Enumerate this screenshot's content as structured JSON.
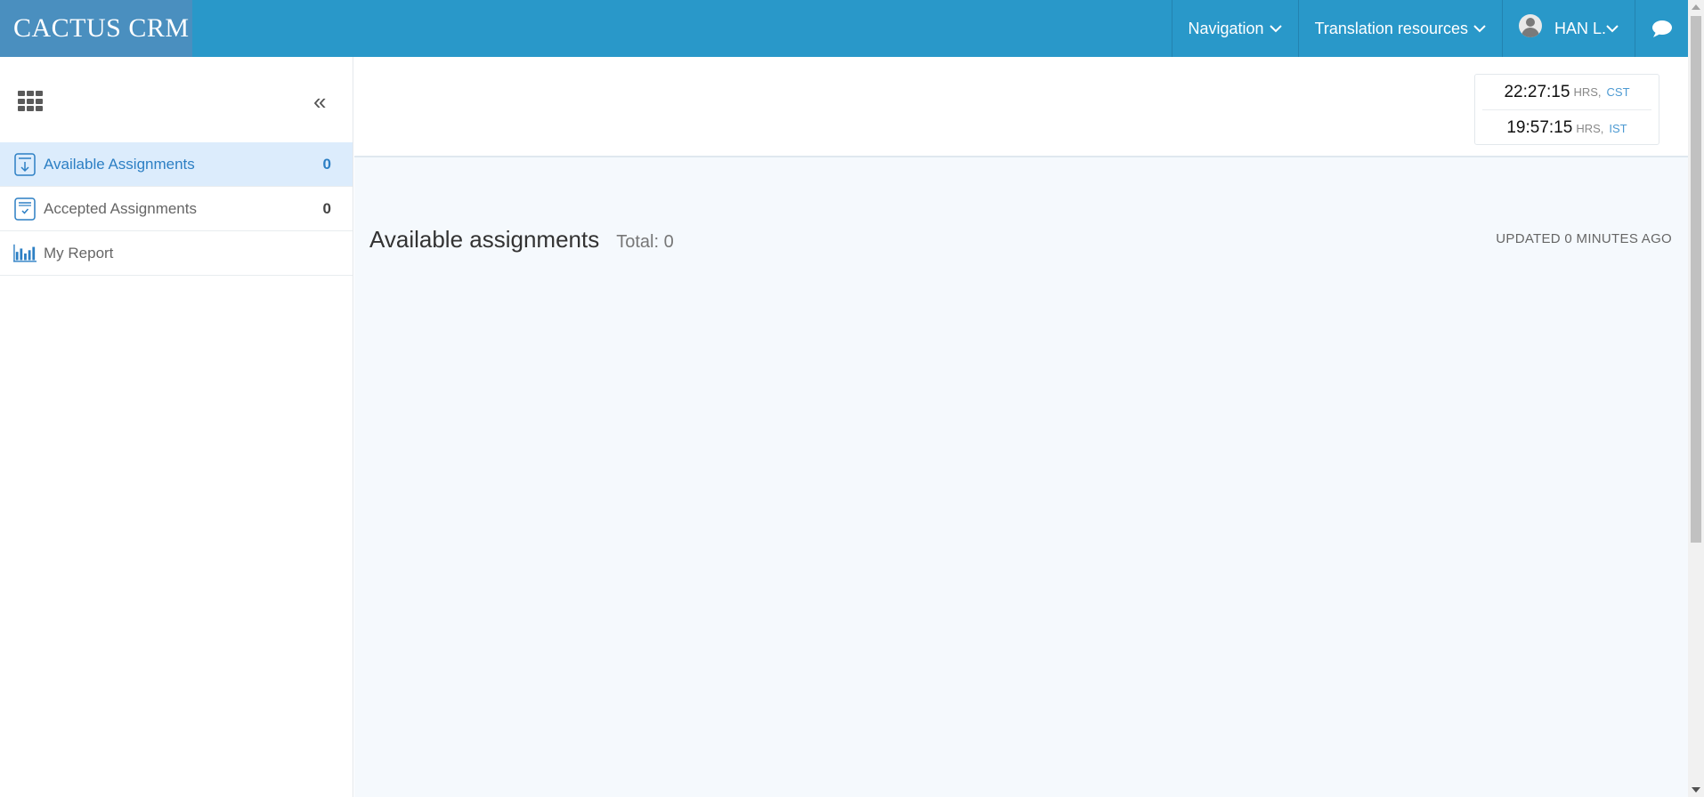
{
  "header": {
    "brand": "CACTUS CRM",
    "nav": {
      "navigation_label": "Navigation",
      "translation_label": "Translation resources",
      "user_label": "HAN L."
    }
  },
  "sidebar": {
    "items": [
      {
        "label": "Available Assignments",
        "count": "0",
        "icon": "download-doc-icon",
        "active": true
      },
      {
        "label": "Accepted Assignments",
        "count": "0",
        "icon": "checked-doc-icon",
        "active": false
      },
      {
        "label": "My Report",
        "count": "",
        "icon": "bar-chart-icon",
        "active": false
      }
    ]
  },
  "clocks": [
    {
      "time": "22:27:15",
      "unit": "HRS,",
      "zone": "CST"
    },
    {
      "time": "19:57:15",
      "unit": "HRS,",
      "zone": "IST"
    }
  ],
  "main": {
    "title": "Available assignments",
    "total": "Total: 0",
    "updated": "UPDATED 0 MINUTES AGO"
  },
  "colors": {
    "topbar": "#2998c9",
    "brand_bg": "#4a8fbf",
    "active_item_bg": "#dcecfc",
    "accent": "#2c7fc4"
  }
}
